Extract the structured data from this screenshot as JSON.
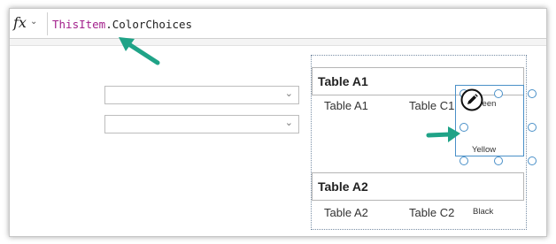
{
  "formula_bar": {
    "fx_label": "fx",
    "formula_keyword": "ThisItem",
    "formula_property": ".ColorChoices"
  },
  "gallery": {
    "items": [
      {
        "header": "Table A1",
        "col1": "Table A1",
        "col2": "Table C1",
        "choices": [
          "Green",
          "Yellow"
        ]
      },
      {
        "header": "Table A2",
        "col1": "Table A2",
        "col2": "Table C2",
        "choices": [
          "Black"
        ]
      }
    ]
  },
  "colors": {
    "formula_keyword": "#a3218c",
    "selection": "#4a90c8",
    "callout_arrow": "#1fa387"
  },
  "icons": {
    "dropdown": "chevron-down-icon",
    "edit": "pencil-edit-icon",
    "callout": "arrow-icon"
  }
}
